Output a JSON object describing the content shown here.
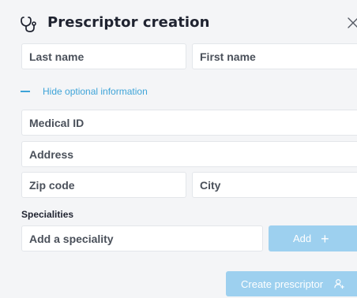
{
  "dialog": {
    "title": "Prescriptor creation",
    "title_icon": "stethoscope-icon",
    "close_icon": "close-icon"
  },
  "fields": {
    "last_name": "Last name",
    "first_name": "First name",
    "medical_id": "Medical ID",
    "address": "Address",
    "zip_code": "Zip code",
    "city": "City"
  },
  "optional_toggle": {
    "label": "Hide optional information"
  },
  "specialities": {
    "label": "Specialities",
    "placeholder": "Add a speciality",
    "add_label": "Add",
    "add_icon": "plus-icon"
  },
  "footer": {
    "create_label": "Create prescriptor",
    "create_icon": "add-user-icon"
  },
  "colors": {
    "accent": "#3ea4d8",
    "button_bg": "#9dd0ef",
    "background": "#f4f5f7"
  }
}
